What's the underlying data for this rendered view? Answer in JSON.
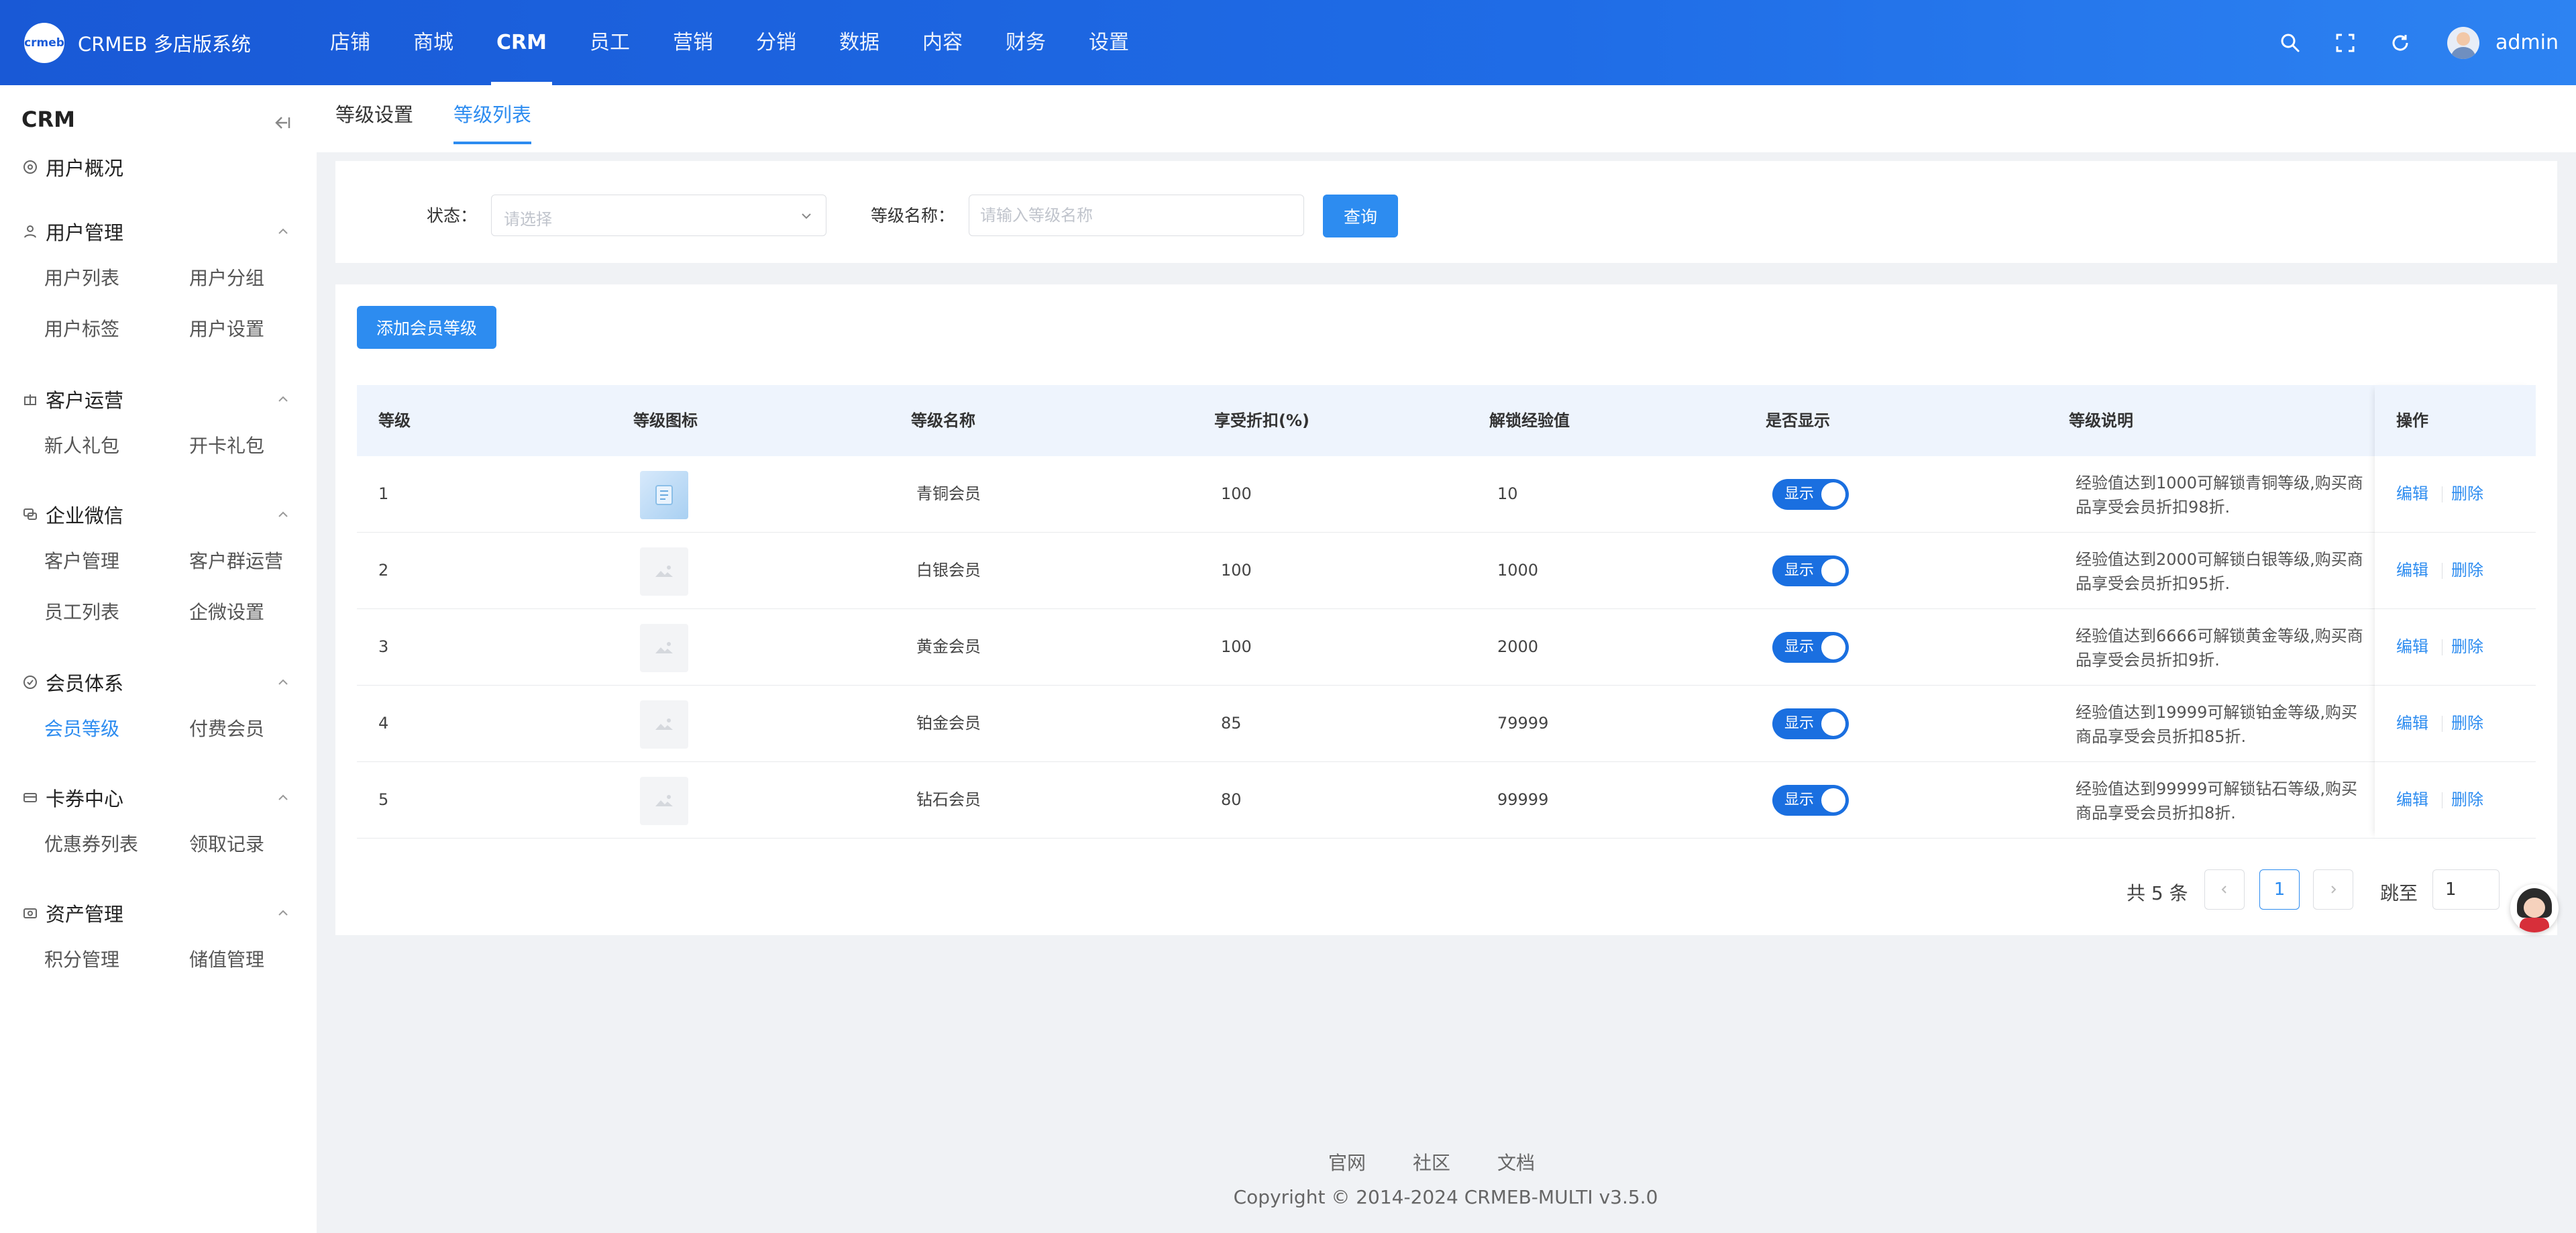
{
  "app": {
    "logo_text": "crmeb",
    "title": "CRMEB 多店版系统"
  },
  "topnav": [
    "店铺",
    "商城",
    "CRM",
    "员工",
    "营销",
    "分销",
    "数据",
    "内容",
    "财务",
    "设置"
  ],
  "user": {
    "name": "admin"
  },
  "sidebar": {
    "title": "CRM",
    "overview": "用户概况",
    "groups": [
      {
        "label": "用户管理",
        "items": [
          "用户列表",
          "用户分组",
          "用户标签",
          "用户设置"
        ]
      },
      {
        "label": "客户运营",
        "items": [
          "新人礼包",
          "开卡礼包"
        ]
      },
      {
        "label": "企业微信",
        "items": [
          "客户管理",
          "客户群运营",
          "员工列表",
          "企微设置"
        ]
      },
      {
        "label": "会员体系",
        "items": [
          "会员等级",
          "付费会员"
        ]
      },
      {
        "label": "卡券中心",
        "items": [
          "优惠券列表",
          "领取记录"
        ]
      },
      {
        "label": "资产管理",
        "items": [
          "积分管理",
          "储值管理"
        ]
      }
    ]
  },
  "tabs": [
    "等级设置",
    "等级列表"
  ],
  "filter": {
    "status_label": "状态：",
    "status_placeholder": "请选择",
    "name_label": "等级名称：",
    "name_placeholder": "请输入等级名称",
    "query_button": "查询"
  },
  "add_button": "添加会员等级",
  "table": {
    "headers": [
      "等级",
      "等级图标",
      "等级名称",
      "享受折扣(%)",
      "解锁经验值",
      "是否显示",
      "等级说明",
      "操作"
    ],
    "rows": [
      {
        "level": "1",
        "name": "青铜会员",
        "discount": "100",
        "exp": "10",
        "show": "显示",
        "desc": "经验值达到1000可解锁青铜等级,购买商品享受会员折扣98折.",
        "edit": "编辑",
        "delete": "删除"
      },
      {
        "level": "2",
        "name": "白银会员",
        "discount": "100",
        "exp": "1000",
        "show": "显示",
        "desc": "经验值达到2000可解锁白银等级,购买商品享受会员折扣95折.",
        "edit": "编辑",
        "delete": "删除"
      },
      {
        "level": "3",
        "name": "黄金会员",
        "discount": "100",
        "exp": "2000",
        "show": "显示",
        "desc": "经验值达到6666可解锁黄金等级,购买商品享受会员折扣9折.",
        "edit": "编辑",
        "delete": "删除"
      },
      {
        "level": "4",
        "name": "铂金会员",
        "discount": "85",
        "exp": "79999",
        "show": "显示",
        "desc": "经验值达到19999可解锁铂金等级,购买商品享受会员折扣85折.",
        "edit": "编辑",
        "delete": "删除"
      },
      {
        "level": "5",
        "name": "钻石会员",
        "discount": "80",
        "exp": "99999",
        "show": "显示",
        "desc": "经验值达到99999可解锁钻石等级,购买商品享受会员折扣8折.",
        "edit": "编辑",
        "delete": "删除"
      }
    ]
  },
  "pagination": {
    "total": "共 5 条",
    "current": "1",
    "jump_label": "跳至",
    "jump_value": "1"
  },
  "footer": {
    "links": [
      "官网",
      "社区",
      "文档"
    ],
    "copyright": "Copyright © 2014-2024 CRMEB-MULTI v3.5.0"
  },
  "colors": {
    "primary": "#2d8cf0",
    "topbar": "#1f6ce6",
    "switch_on": "#1a6fe0"
  }
}
